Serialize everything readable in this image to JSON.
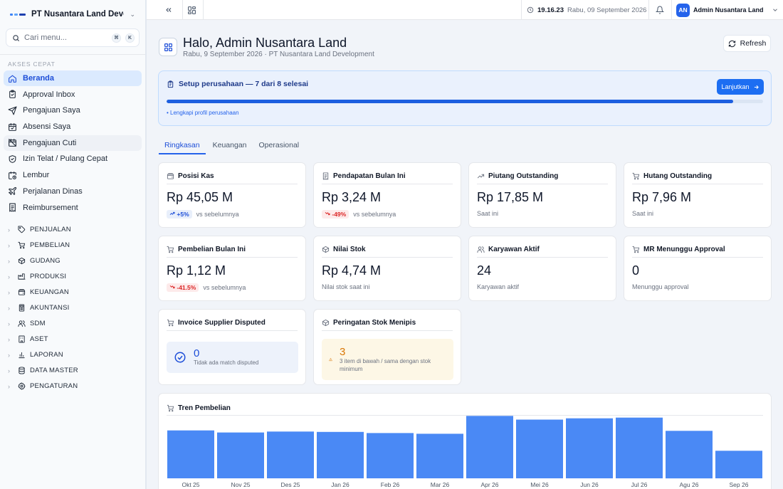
{
  "sidebar": {
    "company": "PT Nusantara Land Develop...",
    "search_placeholder": "Cari menu...",
    "kbd": [
      "⌘",
      "K"
    ],
    "section_label": "AKSES CEPAT",
    "items": [
      {
        "label": "Beranda",
        "icon": "home-icon"
      },
      {
        "label": "Approval Inbox",
        "icon": "clipboard-check-icon"
      },
      {
        "label": "Pengajuan Saya",
        "icon": "send-icon"
      },
      {
        "label": "Absensi Saya",
        "icon": "calendar-check-icon"
      },
      {
        "label": "Pengajuan Cuti",
        "icon": "calendar-off-icon"
      },
      {
        "label": "Izin Telat / Pulang Cepat",
        "icon": "shield-check-icon"
      },
      {
        "label": "Lembur",
        "icon": "calendar-clock-icon"
      },
      {
        "label": "Perjalanan Dinas",
        "icon": "plane-icon"
      },
      {
        "label": "Reimbursement",
        "icon": "receipt-icon"
      }
    ],
    "groups": [
      {
        "label": "PENJUALAN",
        "icon": "tag-icon"
      },
      {
        "label": "PEMBELIAN",
        "icon": "cart-icon"
      },
      {
        "label": "GUDANG",
        "icon": "box-icon"
      },
      {
        "label": "PRODUKSI",
        "icon": "factory-icon"
      },
      {
        "label": "KEUANGAN",
        "icon": "wallet-icon"
      },
      {
        "label": "AKUNTANSI",
        "icon": "calculator-icon"
      },
      {
        "label": "SDM",
        "icon": "users-icon"
      },
      {
        "label": "ASET",
        "icon": "building-icon"
      },
      {
        "label": "LAPORAN",
        "icon": "bar-chart-icon"
      },
      {
        "label": "DATA MASTER",
        "icon": "database-icon"
      },
      {
        "label": "PENGATURAN",
        "icon": "gear-icon"
      }
    ]
  },
  "topbar": {
    "time": "19.16.23",
    "date": "Rabu, 09 September 2026",
    "avatar_initials": "AN",
    "user_name": "Admin Nusantara Land"
  },
  "header": {
    "title": "Halo, Admin Nusantara Land",
    "subtitle": "Rabu, 9 September 2026 · PT Nusantara Land Development",
    "refresh_label": "Refresh"
  },
  "setup": {
    "title": "Setup perusahaan — 7 dari 8 selesai",
    "button_label": "Lanjutkan",
    "progress": 0.95,
    "note": "• Lengkapi profil perusahaan"
  },
  "tabs": [
    "Ringkasan",
    "Keuangan",
    "Operasional"
  ],
  "cards": [
    {
      "title": "Posisi Kas",
      "value": "Rp 45,05 M",
      "badge": "+5%",
      "trend": "up",
      "foot": "vs sebelumnya",
      "icon": "wallet-icon"
    },
    {
      "title": "Pendapatan Bulan Ini",
      "value": "Rp 3,24 M",
      "badge": "-49%",
      "trend": "down",
      "foot": "vs sebelumnya",
      "icon": "receipt-icon"
    },
    {
      "title": "Piutang Outstanding",
      "value": "Rp 17,85 M",
      "badge": "",
      "trend": "",
      "foot": "Saat ini",
      "icon": "trending-up-icon"
    },
    {
      "title": "Hutang Outstanding",
      "value": "Rp 7,96 M",
      "badge": "",
      "trend": "",
      "foot": "Saat ini",
      "icon": "cart-icon"
    },
    {
      "title": "Pembelian Bulan Ini",
      "value": "Rp 1,12 M",
      "badge": "-41.5%",
      "trend": "down",
      "foot": "vs sebelumnya",
      "icon": "cart-icon"
    },
    {
      "title": "Nilai Stok",
      "value": "Rp 4,74 M",
      "badge": "",
      "trend": "",
      "foot": "Nilai stok saat ini",
      "icon": "box-icon"
    },
    {
      "title": "Karyawan Aktif",
      "value": "24",
      "badge": "",
      "trend": "",
      "foot": "Karyawan aktif",
      "icon": "users-icon"
    },
    {
      "title": "MR Menunggu Approval",
      "value": "0",
      "badge": "",
      "trend": "",
      "foot": "Menunggu approval",
      "icon": "cart-icon"
    }
  ],
  "disputed": {
    "title": "Invoice Supplier Disputed",
    "value": "0",
    "text": "Tidak ada match disputed"
  },
  "lowstock": {
    "title": "Peringatan Stok Menipis",
    "value": "3",
    "text": "3 item di bawah / sama dengan stok minimum"
  },
  "colors": {
    "accent": "#2563eb",
    "bar": "#4a89f5",
    "down": "#dc2626",
    "warning": "#d97706"
  },
  "chart_data": {
    "type": "bar",
    "title": "Tren Pembelian",
    "categories": [
      "Okt 25",
      "Nov 25",
      "Des 25",
      "Jan 26",
      "Feb 26",
      "Mar 26",
      "Apr 26",
      "Mei 26",
      "Jun 26",
      "Jul 26",
      "Agu 26",
      "Sep 26"
    ],
    "values": [
      2.57,
      2.46,
      2.51,
      2.49,
      2.43,
      2.39,
      3.35,
      3.15,
      3.22,
      3.26,
      2.55,
      1.48
    ],
    "ylim": [
      0,
      3.4
    ],
    "grid": false
  }
}
